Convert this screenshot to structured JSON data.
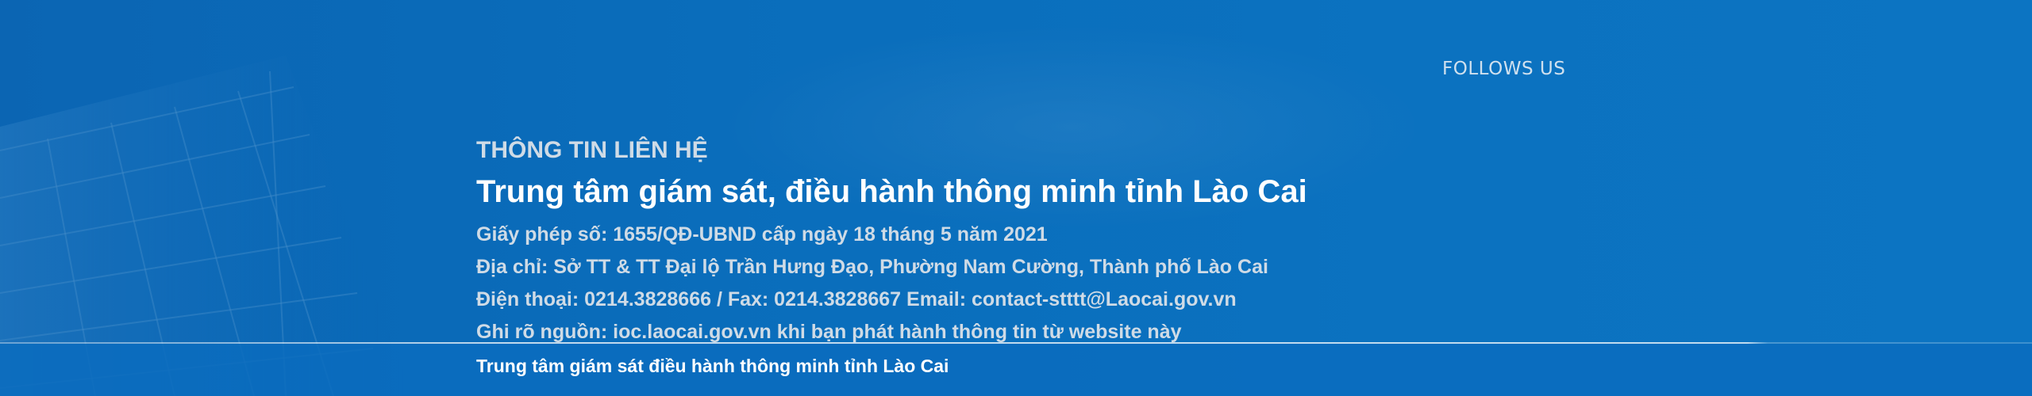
{
  "social": {
    "heading": "FOLLOWS US"
  },
  "contact": {
    "heading": "THÔNG TIN LIÊN HỆ",
    "organization": "Trung tâm giám sát, điều hành thông minh tỉnh Lào Cai",
    "lines": [
      "Giấy phép số: 1655/QĐ-UBND cấp ngày 18 tháng 5 năm 2021",
      "Địa chỉ: Sở TT & TT Đại lộ Trần Hưng Đạo, Phường Nam Cường, Thành phố Lào Cai",
      "Điện thoại: 0214.3828666 / Fax: 0214.3828667 Email: contact-stttt@Laocai.gov.vn",
      "Ghi rõ nguồn: ioc.laocai.gov.vn khi bạn phát hành thông tin từ website này"
    ]
  },
  "footer_bar": {
    "copyright": "Trung tâm giám sát điều hành thông minh tỉnh Lào Cai"
  },
  "colors": {
    "background": "#0a6fbd",
    "heading_text": "#cfdbe6",
    "title_text": "#ffffff"
  }
}
